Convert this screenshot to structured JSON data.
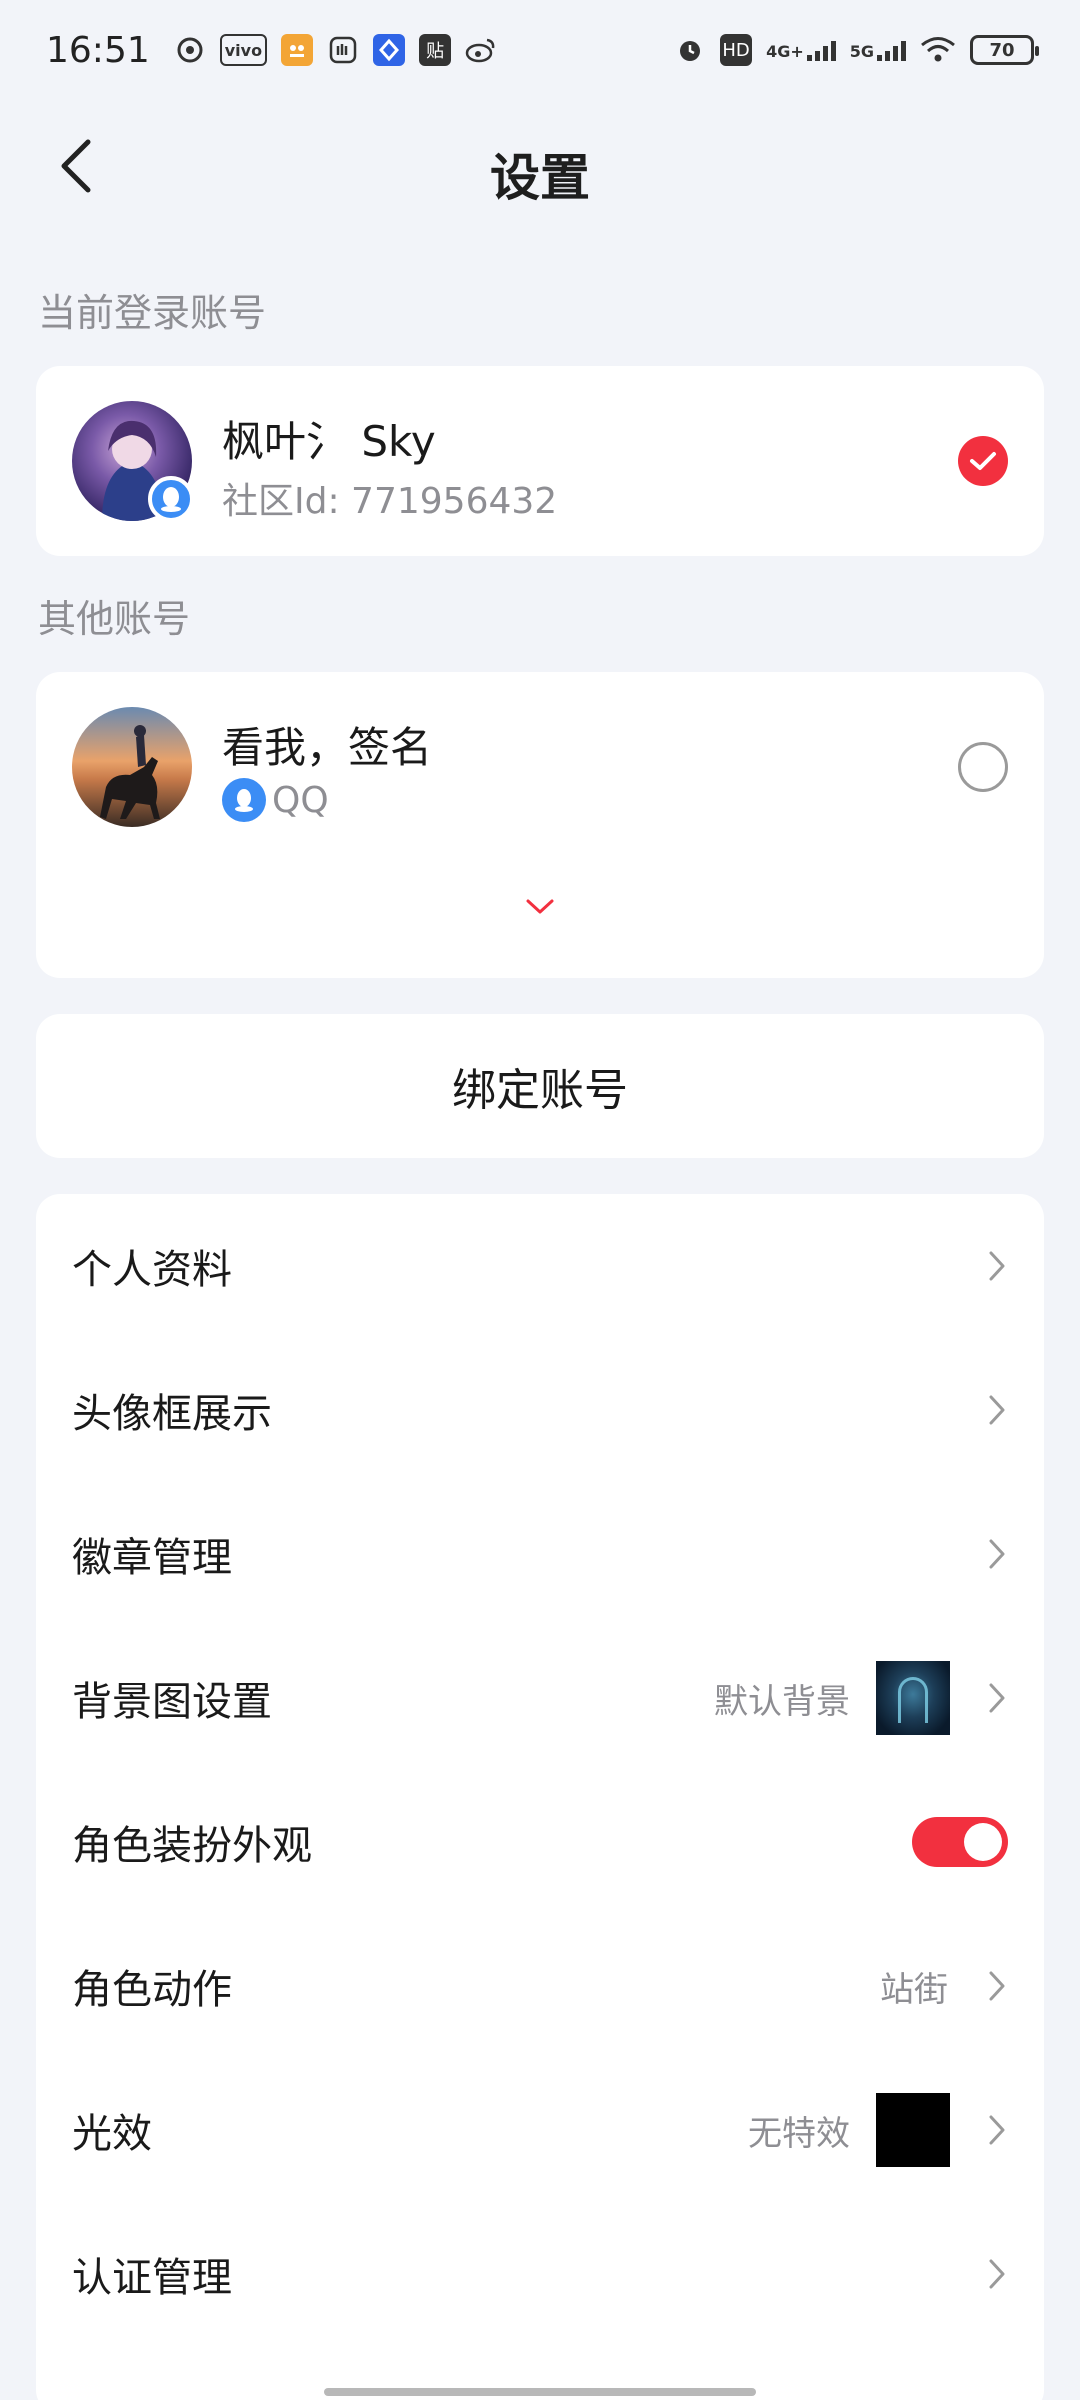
{
  "status_bar": {
    "time": "16:51",
    "notif_icons": [
      "netease-icon",
      "vivo-icon",
      "game-app-icon",
      "hand-app-icon",
      "app-store-icon",
      "tieba-icon",
      "weibo-icon"
    ],
    "tieba_label": "贴",
    "vivo_label": "vivo",
    "hd_label": "HD",
    "net1_label": "4G+",
    "net2_label": "5G",
    "battery_level": "70"
  },
  "header": {
    "title": "设置"
  },
  "current_account": {
    "section_label": "当前登录账号",
    "name": "枫叶氵 Sky",
    "sub": "社区Id: 771956432",
    "selected": true
  },
  "other_accounts": {
    "section_label": "其他账号",
    "items": [
      {
        "name": "看我，签名",
        "sub": "QQ",
        "selected": false
      }
    ]
  },
  "bind_button": {
    "label": "绑定账号"
  },
  "menu": {
    "items": [
      {
        "label": "个人资料"
      },
      {
        "label": "头像框展示"
      },
      {
        "label": "徽章管理"
      },
      {
        "label": "背景图设置",
        "value": "默认背景",
        "thumb": "background-thumbnail"
      },
      {
        "label": "角色装扮外观",
        "toggle": true
      },
      {
        "label": "角色动作",
        "value": "站街"
      },
      {
        "label": "光效",
        "value": "无特效",
        "thumb": "black-thumbnail"
      },
      {
        "label": "认证管理"
      }
    ]
  },
  "colors": {
    "accent": "#f2303f",
    "background": "#f2f4f9",
    "qq_blue": "#3b8df5"
  }
}
